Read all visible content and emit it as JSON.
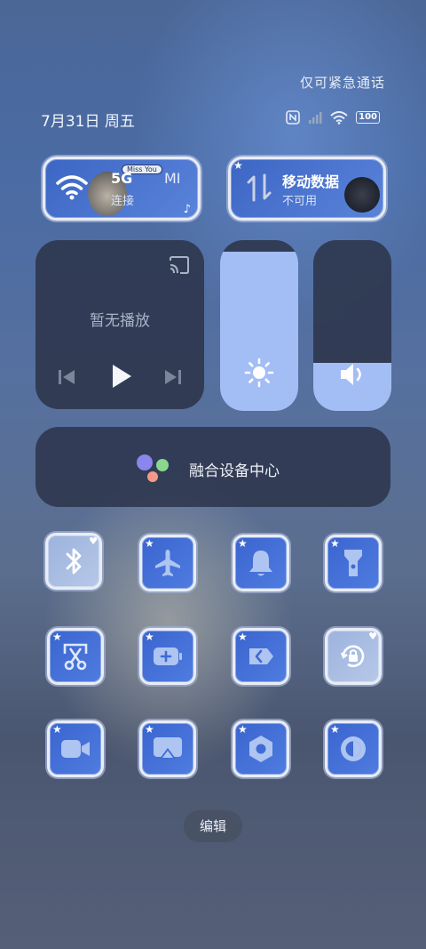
{
  "status_bar": {
    "emergency_text": "仅可紧急通话",
    "date": "7月31日 周五",
    "battery": "100",
    "icons": [
      "nfc-icon",
      "signal-icon",
      "wifi-icon",
      "battery-icon"
    ]
  },
  "wifi_tile": {
    "network": "5G",
    "network2": "MI",
    "status": "连接",
    "sticker_text": "Miss You",
    "icon": "wifi-icon"
  },
  "data_tile": {
    "title": "移动数据",
    "status": "不可用",
    "icon": "mobile-data-arrows-icon"
  },
  "media": {
    "status": "暂无播放",
    "icons": [
      "cast-icon",
      "previous-icon",
      "play-icon",
      "next-icon"
    ]
  },
  "sliders": {
    "brightness_level": 0.93,
    "volume_level": 0.28,
    "icons": [
      "brightness-sun-icon",
      "speaker-icon"
    ]
  },
  "fusion": {
    "label": "融合设备中心",
    "icon": "fusion-dots-icon"
  },
  "toggles": [
    {
      "icon": "bluetooth-icon"
    },
    {
      "icon": "airplane-icon"
    },
    {
      "icon": "bell-icon"
    },
    {
      "icon": "flashlight-icon"
    },
    {
      "icon": "scissors-screenshot-icon"
    },
    {
      "icon": "battery-saver-icon"
    },
    {
      "icon": "code-share-icon"
    },
    {
      "icon": "rotation-lock-icon"
    },
    {
      "icon": "video-camera-icon"
    },
    {
      "icon": "screen-cast-icon"
    },
    {
      "icon": "settings-hex-icon"
    },
    {
      "icon": "dark-mode-icon"
    }
  ],
  "edit_label": "编辑",
  "colors": {
    "tile_blue": "#3a65cf",
    "slider_fill": "#a3bdf5",
    "panel_dark": "#2c344a"
  }
}
